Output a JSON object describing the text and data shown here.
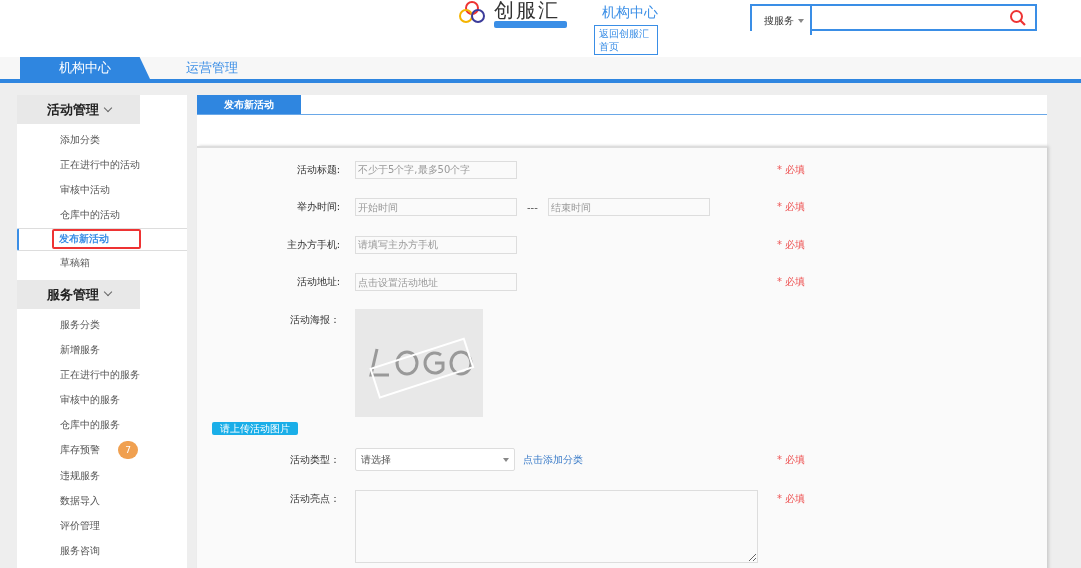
{
  "header": {
    "brand": "创服汇",
    "org_center": "机构中心",
    "home_link": "返回创服汇首页",
    "search": {
      "scope": "搜服务"
    }
  },
  "tabs": [
    {
      "label": "机构中心",
      "selected": true
    },
    {
      "label": "运营管理",
      "selected": false
    }
  ],
  "sidebar": {
    "groups": [
      {
        "title": "活动管理",
        "expanded": true,
        "items": [
          {
            "label": "添加分类",
            "selected": false
          },
          {
            "label": "正在进行中的活动",
            "selected": false
          },
          {
            "label": "审核中活动",
            "selected": false
          },
          {
            "label": "仓库中的活动",
            "selected": false
          },
          {
            "label": "发布新活动",
            "selected": true
          },
          {
            "label": "草稿箱",
            "selected": false
          }
        ]
      },
      {
        "title": "服务管理",
        "expanded": true,
        "items": [
          {
            "label": "服务分类",
            "selected": false
          },
          {
            "label": "新增服务",
            "selected": false
          },
          {
            "label": "正在进行中的服务",
            "selected": false
          },
          {
            "label": "审核中的服务",
            "selected": false
          },
          {
            "label": "仓库中的服务",
            "selected": false
          },
          {
            "label": "库存预警",
            "selected": false,
            "badge": "7"
          },
          {
            "label": "违规服务",
            "selected": false
          },
          {
            "label": "数据导入",
            "selected": false
          },
          {
            "label": "评价管理",
            "selected": false
          },
          {
            "label": "服务咨询",
            "selected": false
          }
        ]
      }
    ]
  },
  "panel": {
    "tab": "发布新活动",
    "form": [
      {
        "kind": "text",
        "label": "活动标题:",
        "placeholder": "不少于5个字,最多50个字",
        "required": "* 必填"
      },
      {
        "kind": "daterange",
        "label": "举办时间:",
        "placeholder": "开始时间",
        "separator": "---",
        "placeholder_end": "结束时间",
        "required": "* 必填"
      },
      {
        "kind": "text",
        "label": "主办方手机:",
        "placeholder": "请填写主办方手机",
        "required": "* 必填"
      },
      {
        "kind": "text",
        "label": "活动地址:",
        "placeholder": "点击设置活动地址",
        "required": "* 必填"
      },
      {
        "kind": "image",
        "label": "活动海报：",
        "button": "请上传活动图片"
      },
      {
        "kind": "select",
        "label": "活动类型：",
        "value": "请选择",
        "link": "点击添加分类",
        "required": "* 必填"
      },
      {
        "kind": "textarea",
        "label": "活动亮点：",
        "required": "* 必填"
      }
    ]
  }
}
